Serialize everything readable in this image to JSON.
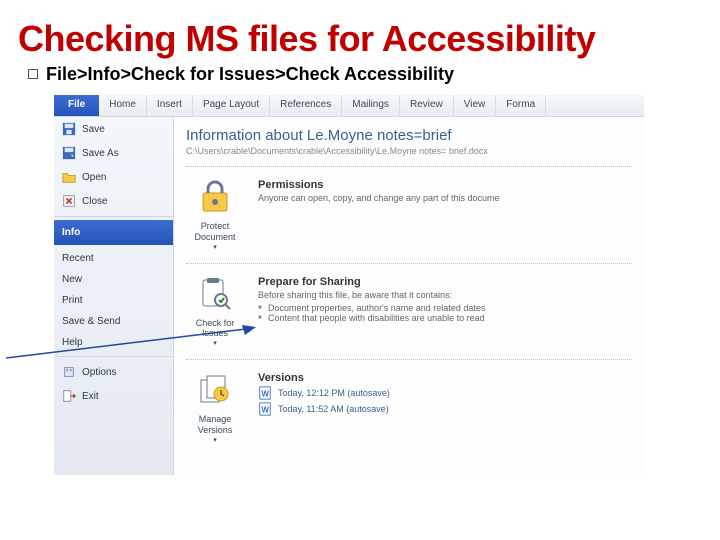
{
  "slide": {
    "title": "Checking MS files for Accessibility",
    "bullet": "File>Info>Check for Issues>Check Accessibility"
  },
  "ribbon": {
    "file": "File",
    "tabs": [
      "Home",
      "Insert",
      "Page Layout",
      "References",
      "Mailings",
      "Review",
      "View",
      "Forma"
    ]
  },
  "sidebar": {
    "save": "Save",
    "saveas": "Save As",
    "open": "Open",
    "close": "Close",
    "info": "Info",
    "recent": "Recent",
    "new": "New",
    "print": "Print",
    "savesend": "Save & Send",
    "help": "Help",
    "options": "Options",
    "exit": "Exit"
  },
  "main": {
    "doc_title": "Information about Le.Moyne notes=brief",
    "doc_path": "C:\\Users\\crable\\Documents\\crable\\Accessibility\\Le.Moyne notes= brief.docx",
    "protect_btn": "Protect Document",
    "perm_h": "Permissions",
    "perm_p": "Anyone can open, copy, and change any part of this docume",
    "check_btn": "Check for Issues",
    "share_h": "Prepare for Sharing",
    "share_p": "Before sharing this file, be aware that it contains:",
    "share_li1": "Document properties, author's name and related dates",
    "share_li2": "Content that people with disabilities are unable to read",
    "versions_btn": "Manage Versions",
    "ver_h": "Versions",
    "ver1": "Today, 12:12 PM (autosave)",
    "ver2": "Today, 11:52 AM (autosave)"
  }
}
